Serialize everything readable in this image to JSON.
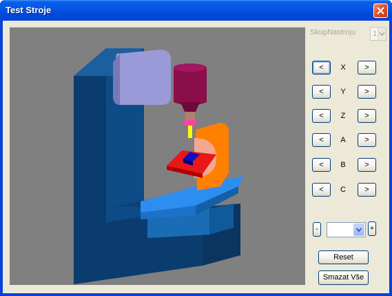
{
  "window": {
    "title": "Test Stroje"
  },
  "tool": {
    "label": "SkupNastroju",
    "value": "1"
  },
  "axes": [
    {
      "name": "X",
      "minus": "<",
      "plus": ">"
    },
    {
      "name": "Y",
      "minus": "<",
      "plus": ">"
    },
    {
      "name": "Z",
      "minus": "<",
      "plus": ">"
    },
    {
      "name": "A",
      "minus": "<",
      "plus": ">"
    },
    {
      "name": "B",
      "minus": "<",
      "plus": ">"
    },
    {
      "name": "C",
      "minus": "<",
      "plus": ">"
    }
  ],
  "step": {
    "minus_label": "-",
    "plus_label": "+",
    "value": ""
  },
  "buttons": {
    "reset": "Reset",
    "clear_all": "Smazat Vše"
  },
  "icons": {
    "close": "close-icon",
    "dropdown": "chevron-down-icon"
  },
  "colors": {
    "titlebar": "#0554e3",
    "viewport_bg": "#808080",
    "machine_frame": "#0a4a80",
    "spindle_head": "#9a9ad8",
    "spindle": "#8a0e4a",
    "rotary_table": "#ff8000",
    "fixture": "#e81818",
    "workpiece": "#1010c0",
    "worktable": "#2080e0"
  }
}
